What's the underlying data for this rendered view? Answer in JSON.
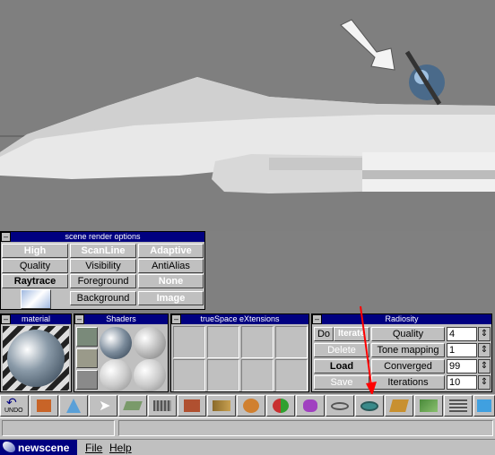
{
  "render_panel": {
    "title": "scene render options",
    "rows": [
      [
        "High",
        "ScanLine",
        "Adaptive"
      ],
      [
        "Quality",
        "Visibility",
        "AntiAlias"
      ],
      [
        "Raytrace",
        "Foreground",
        "None"
      ],
      [
        "",
        "Background",
        "Image"
      ]
    ]
  },
  "material_panel": {
    "title": "material"
  },
  "shaders_panel": {
    "title": "Shaders"
  },
  "extensions_panel": {
    "title": "trueSpace eXtensions"
  },
  "radiosity": {
    "title": "Radiosity",
    "do_label": "Do",
    "iterate_label": "Iterate",
    "delete_label": "Delete",
    "load_label": "Load",
    "save_label": "Save",
    "rows": [
      {
        "label": "Quality",
        "value": "4"
      },
      {
        "label": "Tone mapping",
        "value": "1"
      },
      {
        "label": "Converged",
        "value": "99"
      },
      {
        "label": "Iterations",
        "value": "10"
      }
    ]
  },
  "toolbar": {
    "undo_label": "UNDO"
  },
  "menubar": {
    "scene_name": "newscene",
    "file_label": "File",
    "help_label": "Help"
  },
  "icons": [
    "undo-icon",
    "object-library-icon",
    "paint-icon",
    "pointer-icon",
    "object-tool-icon",
    "move-icon",
    "render-object-icon",
    "render-scene-icon",
    "primitives-icon",
    "material-icon",
    "lights-icon",
    "spline-icon",
    "radiosity-icon",
    "deform-icon",
    "boolean-icon",
    "grid-icon",
    "cube-icon",
    "close-icon"
  ],
  "colors": {
    "title_bar": "#000080",
    "panel": "#c0c0c0",
    "viewport": "#7f7f7f",
    "annotation_arrow": "#ff0000"
  }
}
